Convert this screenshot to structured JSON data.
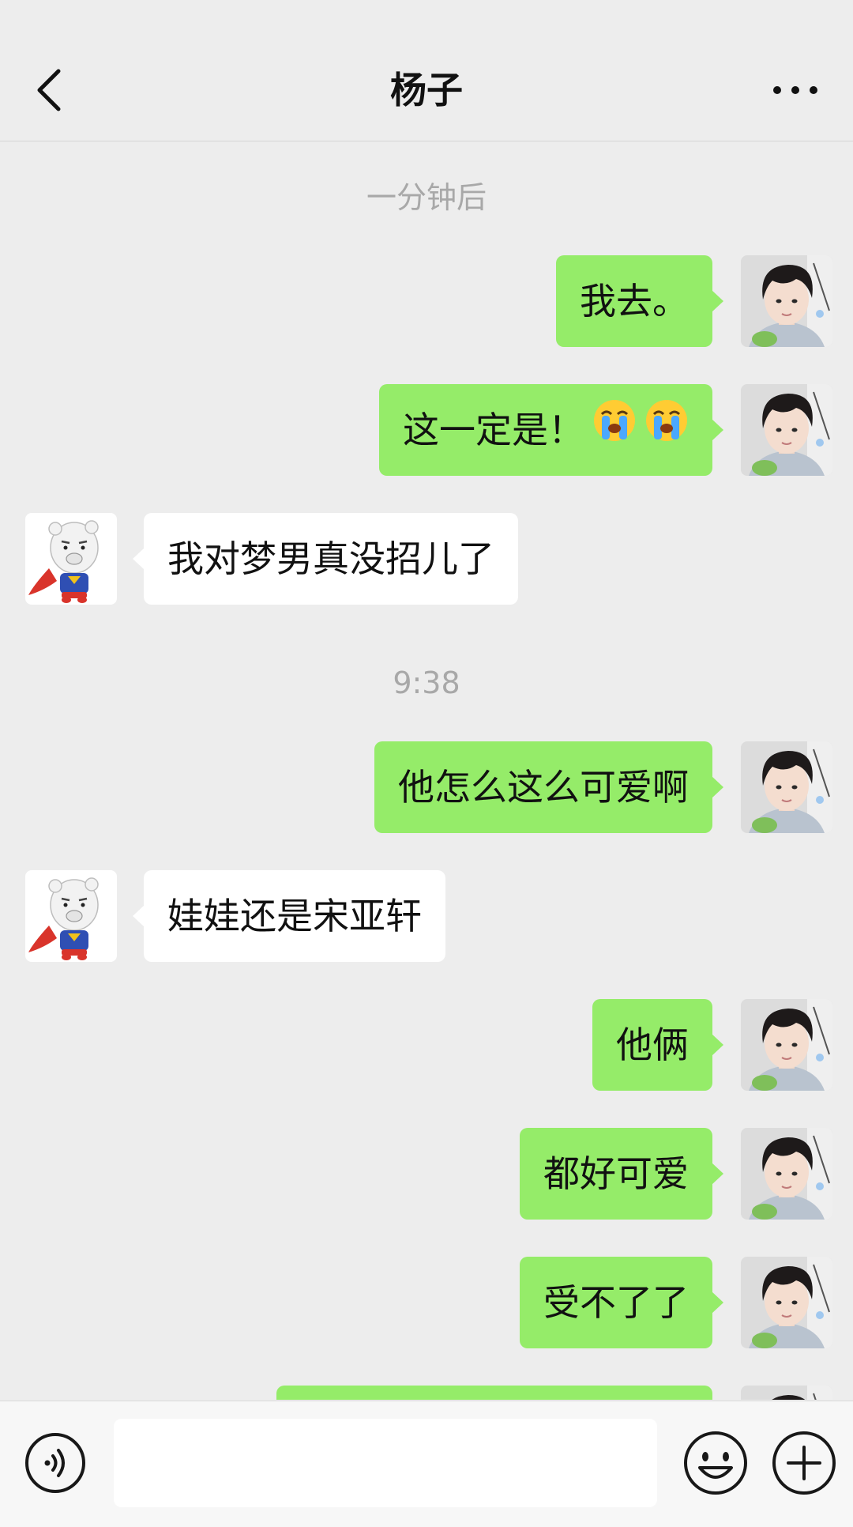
{
  "header": {
    "title": "杨子",
    "back_icon": "chevron-left-icon",
    "more_icon": "ellipsis-icon"
  },
  "colors": {
    "background": "#ededed",
    "sent_bubble": "#95ec69",
    "received_bubble": "#ffffff",
    "timestamp": "#a8a8a8"
  },
  "timestamps": [
    "一分钟后",
    "9:38"
  ],
  "messages": [
    {
      "direction": "out",
      "text": "我去。",
      "avatar": "boy-avatar"
    },
    {
      "direction": "out",
      "text": "这一定是！",
      "emoji": "loudly-crying-face-icon",
      "emoji_count": 2,
      "avatar": "boy-avatar"
    },
    {
      "direction": "in",
      "text": "我对梦男真没招儿了",
      "avatar": "pig-superman-avatar"
    },
    {
      "direction": "out",
      "text": "他怎么这么可爱啊",
      "avatar": "boy-avatar"
    },
    {
      "direction": "in",
      "text": "娃娃还是宋亚轩",
      "avatar": "pig-superman-avatar"
    },
    {
      "direction": "out",
      "text": "他俩",
      "avatar": "boy-avatar"
    },
    {
      "direction": "out",
      "text": "都好可爱",
      "avatar": "boy-avatar"
    },
    {
      "direction": "out",
      "text": "受不了了",
      "avatar": "boy-avatar"
    },
    {
      "direction": "out",
      "text": "",
      "avatar": "boy-avatar",
      "partially_visible": true
    }
  ],
  "input_bar": {
    "voice_icon": "voice-icon",
    "emoji_icon": "smiley-icon",
    "plus_icon": "plus-circle-icon",
    "input_value": ""
  }
}
